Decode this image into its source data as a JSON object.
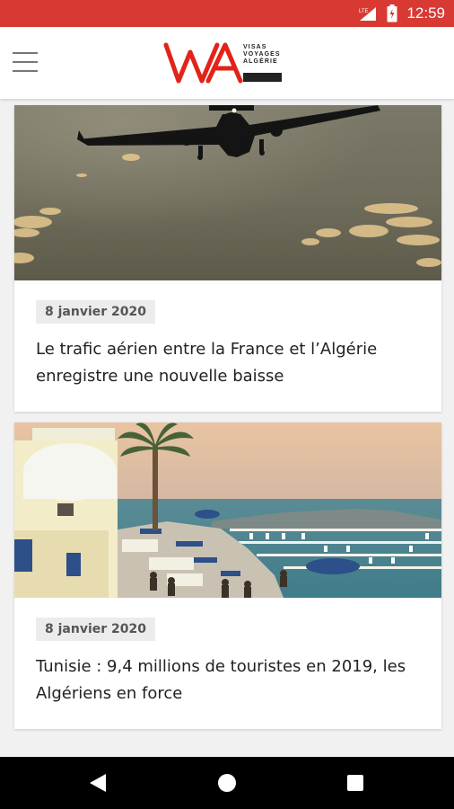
{
  "status_bar": {
    "time": "12:59",
    "network_label": "LTE",
    "icons": [
      "network-signal-icon",
      "battery-icon"
    ],
    "background": "#d83a33"
  },
  "app_bar": {
    "menu_icon": "hamburger-menu-icon",
    "logo": {
      "letters": "VA",
      "lines": [
        "VISAS",
        "VOYAGES",
        "ALGÉRIE"
      ],
      "color": "#e2231a"
    }
  },
  "articles": [
    {
      "image": "airplane-photo",
      "date": "8 janvier 2020",
      "title": "Le trafic aérien entre la France et l’Algérie enregistre une nouvelle baisse"
    },
    {
      "image": "sidi-bou-said-harbour-photo",
      "date": "8 janvier 2020",
      "title": "Tunisie : 9,4 millions de touristes en 2019, les Algériens en force"
    }
  ],
  "nav_bar": {
    "icons": [
      "back-icon",
      "home-icon",
      "recents-icon"
    ]
  }
}
